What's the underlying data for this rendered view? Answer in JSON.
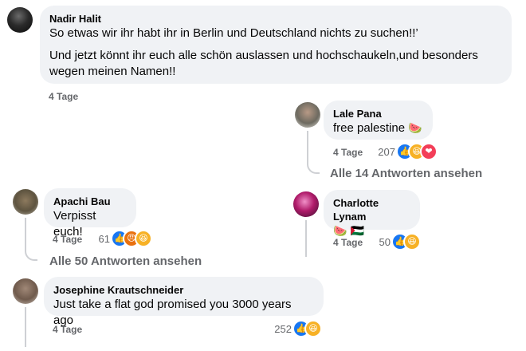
{
  "comments": [
    {
      "author": "Nadir Halit",
      "text_1": "So etwas wir ihr habt ihr in Berlin und Deutschland nichts zu suchen!!’",
      "text_2": "Und jetzt könnt ihr euch alle schön auslassen und hochschaukeln,und besonders wegen meinen Namen!!",
      "time": "4 Tage"
    },
    {
      "author": "Lale Pana",
      "text": "free palestine",
      "emoji": "🍉",
      "time": "4 Tage",
      "reaction_count": "207",
      "reactions": [
        "like-icon",
        "haha-icon",
        "love-icon"
      ],
      "replies_link": "Alle 14 Antworten ansehen"
    },
    {
      "author": "Apachi Bau",
      "text": "Verpisst euch!",
      "time": "4 Tage",
      "reaction_count": "61",
      "reactions": [
        "like-icon",
        "angry-icon",
        "haha-icon"
      ],
      "replies_link": "Alle 50 Antworten ansehen"
    },
    {
      "author": "Charlotte Lynam",
      "emoji_text": "🍉 🇵🇸",
      "time": "4 Tage",
      "reaction_count": "50",
      "reactions": [
        "like-icon",
        "haha-icon"
      ]
    },
    {
      "author": "Josephine Krautschneider",
      "text": "Just take a flat god promised you 3000 years ago",
      "time": "4 Tage",
      "reaction_count": "252",
      "reactions": [
        "like-icon",
        "haha-icon"
      ]
    }
  ],
  "colors": {
    "bubble": "#f0f2f5",
    "meta": "#65676b",
    "like": "#1877f2",
    "haha": "#f7b125",
    "love": "#f33e58",
    "angry": "#e9710f"
  }
}
